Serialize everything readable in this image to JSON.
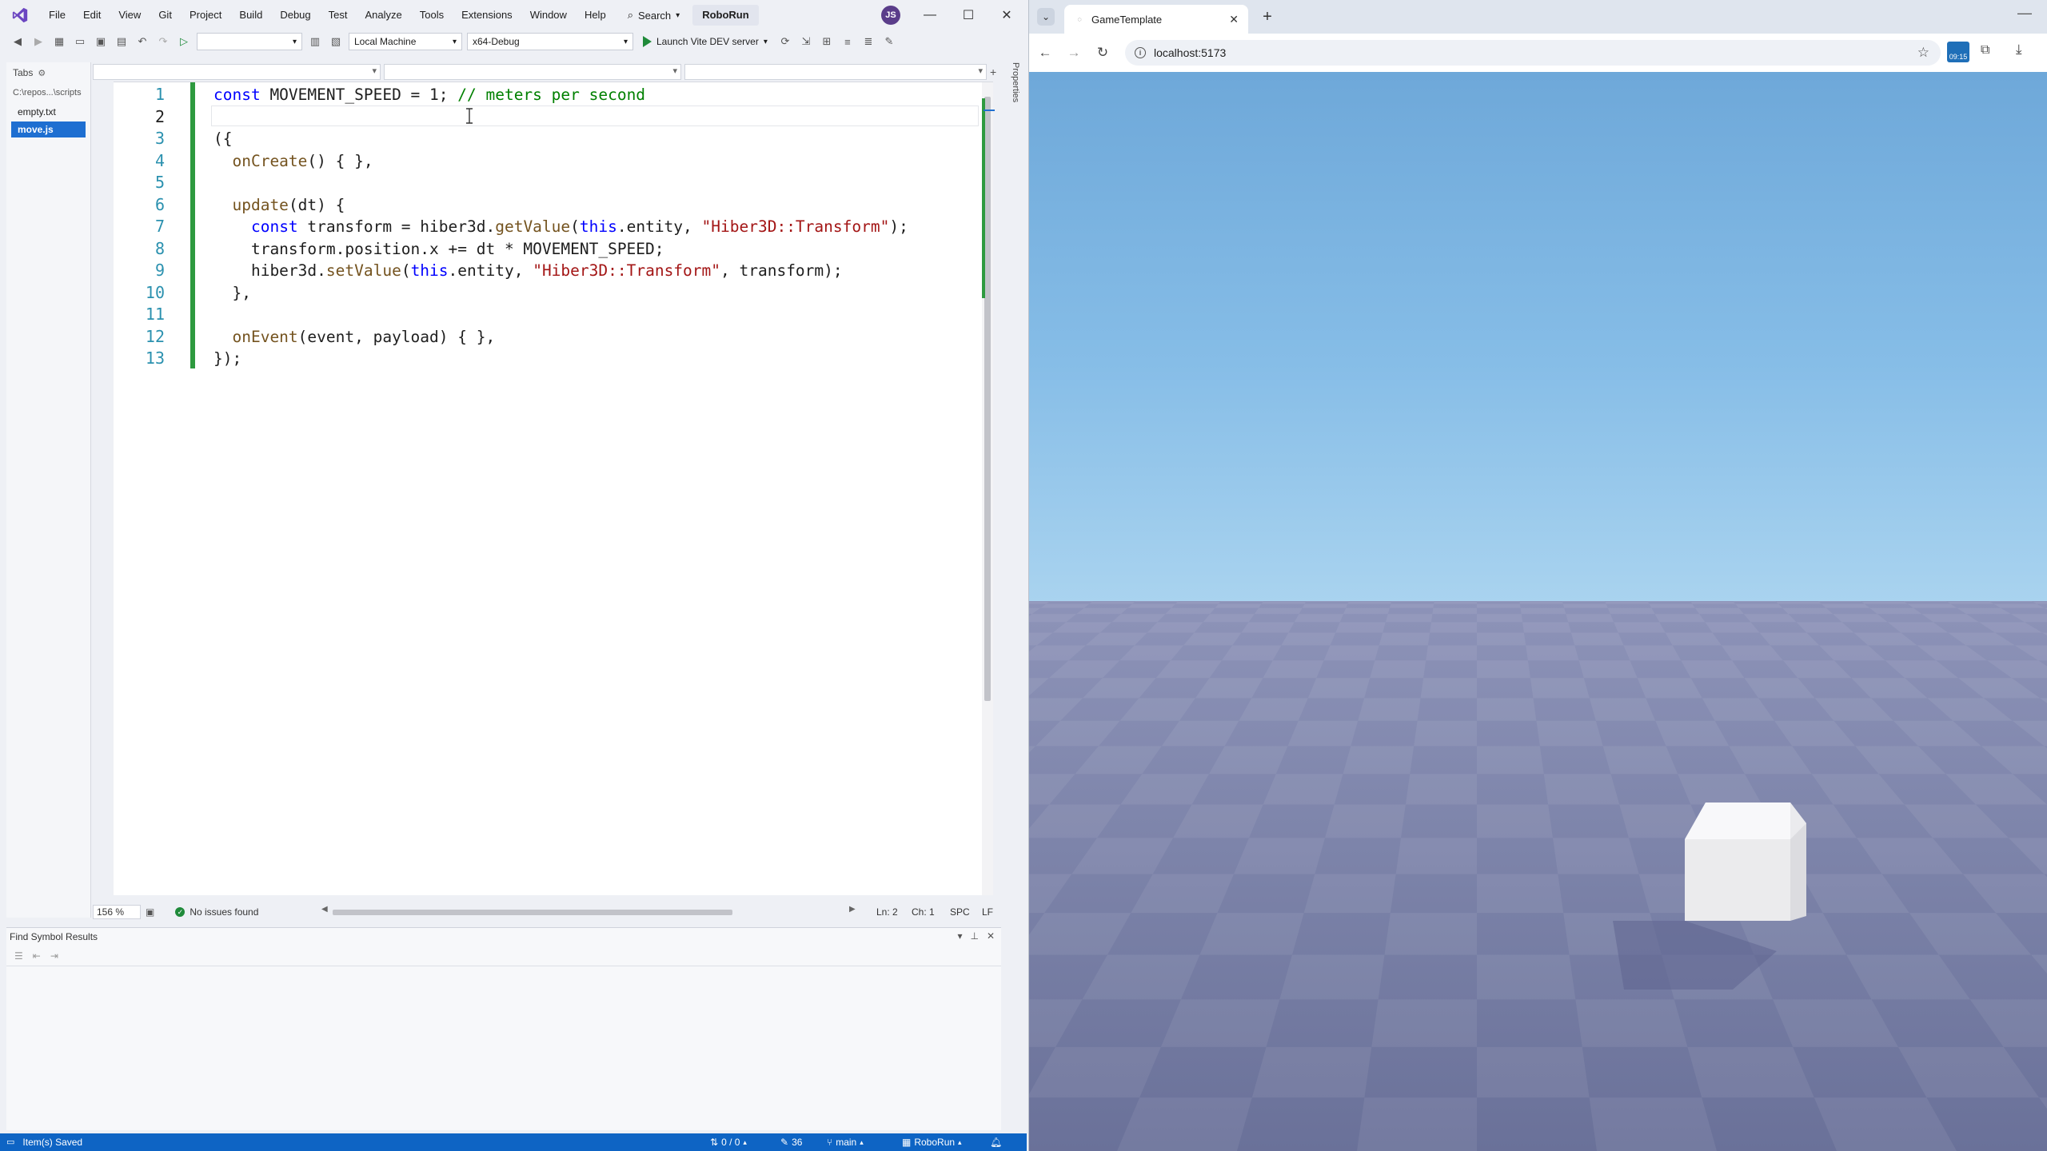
{
  "vs": {
    "menu": [
      "File",
      "Edit",
      "View",
      "Git",
      "Project",
      "Build",
      "Debug",
      "Test",
      "Analyze",
      "Tools",
      "Extensions",
      "Window",
      "Help"
    ],
    "search_label": "Search",
    "solution_name": "RoboRun",
    "avatar_initials": "JS",
    "toolbar": {
      "target_machine": "Local Machine",
      "configuration": "x64-Debug",
      "launch_label": "Launch Vite DEV server"
    },
    "tabs_panel": {
      "title": "Tabs",
      "path": "C:\\repos...\\scripts",
      "files": [
        {
          "name": "empty.txt",
          "active": false
        },
        {
          "name": "move.js",
          "active": true
        }
      ]
    },
    "editor": {
      "current_line": 2,
      "line_numbers": [
        "1",
        "2",
        "3",
        "4",
        "5",
        "6",
        "7",
        "8",
        "9",
        "10",
        "11",
        "12",
        "13"
      ],
      "code_lines": [
        [
          {
            "t": "kw",
            "v": "const"
          },
          {
            "t": "p",
            "v": " MOVEMENT_SPEED = 1; "
          },
          {
            "t": "cm",
            "v": "// meters per second"
          }
        ],
        [],
        [
          {
            "t": "p",
            "v": "({"
          }
        ],
        [
          {
            "t": "p",
            "v": "  "
          },
          {
            "t": "fn",
            "v": "onCreate"
          },
          {
            "t": "p",
            "v": "() { },"
          }
        ],
        [],
        [
          {
            "t": "p",
            "v": "  "
          },
          {
            "t": "fn",
            "v": "update"
          },
          {
            "t": "p",
            "v": "(dt) {"
          }
        ],
        [
          {
            "t": "p",
            "v": "    "
          },
          {
            "t": "kw",
            "v": "const"
          },
          {
            "t": "p",
            "v": " transform = hiber3d."
          },
          {
            "t": "fn",
            "v": "getValue"
          },
          {
            "t": "p",
            "v": "("
          },
          {
            "t": "kw",
            "v": "this"
          },
          {
            "t": "p",
            "v": ".entity, "
          },
          {
            "t": "str",
            "v": "\"Hiber3D::Transform\""
          },
          {
            "t": "p",
            "v": ");"
          }
        ],
        [
          {
            "t": "p",
            "v": "    transform.position.x += dt * MOVEMENT_SPEED;"
          }
        ],
        [
          {
            "t": "p",
            "v": "    hiber3d."
          },
          {
            "t": "fn",
            "v": "setValue"
          },
          {
            "t": "p",
            "v": "("
          },
          {
            "t": "kw",
            "v": "this"
          },
          {
            "t": "p",
            "v": ".entity, "
          },
          {
            "t": "str",
            "v": "\"Hiber3D::Transform\""
          },
          {
            "t": "p",
            "v": ", transform);"
          }
        ],
        [
          {
            "t": "p",
            "v": "  },"
          }
        ],
        [],
        [
          {
            "t": "p",
            "v": "  "
          },
          {
            "t": "fn",
            "v": "onEvent"
          },
          {
            "t": "p",
            "v": "(event, payload) { },"
          }
        ],
        [
          {
            "t": "p",
            "v": "});"
          }
        ]
      ],
      "zoom": "156 %",
      "issues": "No issues found",
      "ln": "Ln: 2",
      "ch": "Ch: 1",
      "encoding": "SPC",
      "eol": "LF"
    },
    "find_panel": {
      "title": "Find Symbol Results"
    },
    "properties_tab": "Properties",
    "status_bar": {
      "message": "Item(s) Saved",
      "changes": "0 / 0",
      "edits": "36",
      "branch": "main",
      "repo": "RoboRun"
    },
    "colors": {
      "keyword": "#0000ff",
      "function": "#74531f",
      "string": "#a31515",
      "comment": "#008000",
      "accent": "#0e64c4"
    }
  },
  "browser": {
    "tab_title": "GameTemplate",
    "url": "localhost:5173",
    "extension_badge": "09:15"
  }
}
